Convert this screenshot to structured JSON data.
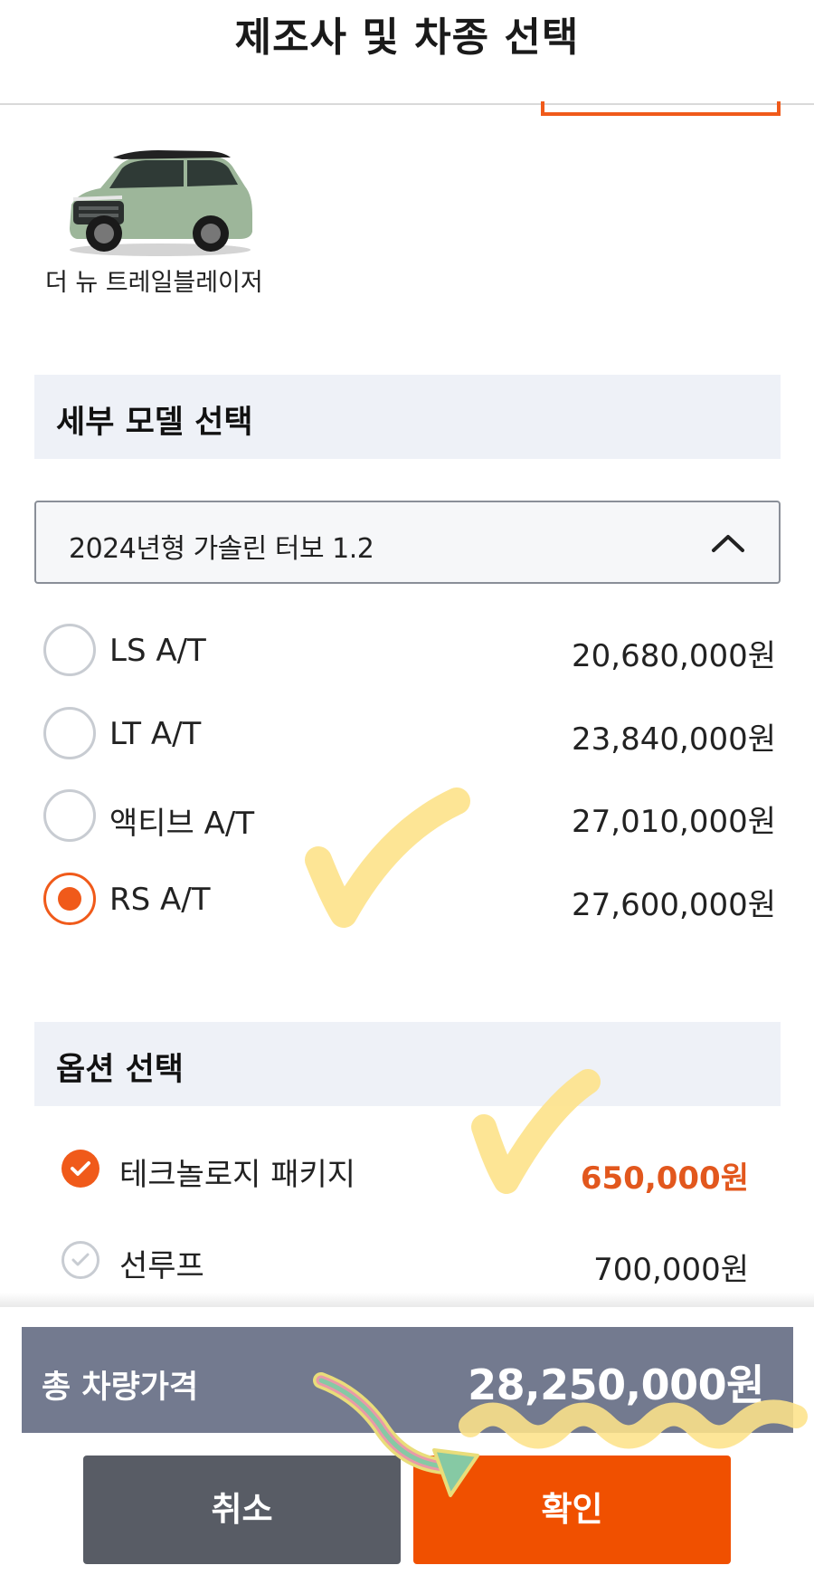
{
  "header": {
    "title": "제조사 및 차종 선택"
  },
  "car": {
    "name": "더 뉴 트레일블레이저"
  },
  "model_section": {
    "title": "세부 모델 선택",
    "dropdown_value": "2024년형 가솔린 터보 1.2",
    "options": [
      {
        "label": "LS A/T",
        "price": "20,680,000원",
        "selected": false
      },
      {
        "label": "LT A/T",
        "price": "23,840,000원",
        "selected": false
      },
      {
        "label": "액티브 A/T",
        "price": "27,010,000원",
        "selected": false
      },
      {
        "label": "RS A/T",
        "price": "27,600,000원",
        "selected": true
      }
    ]
  },
  "option_section": {
    "title": "옵션 선택",
    "options": [
      {
        "label": "테크놀로지 패키지",
        "price": "650,000원",
        "checked": true
      },
      {
        "label": "선루프",
        "price": "700,000원",
        "checked": false
      }
    ]
  },
  "total": {
    "label": "총 차량가격",
    "value": "28,250,000원"
  },
  "buttons": {
    "cancel": "취소",
    "confirm": "확인"
  },
  "colors": {
    "accent": "#f05000",
    "total_bar": "#737a8f",
    "cancel": "#585c65",
    "section_bg": "#eef1f7",
    "annotation": "#fde28a"
  },
  "icons": [
    "chevron-up-icon",
    "check-icon",
    "car-image"
  ]
}
